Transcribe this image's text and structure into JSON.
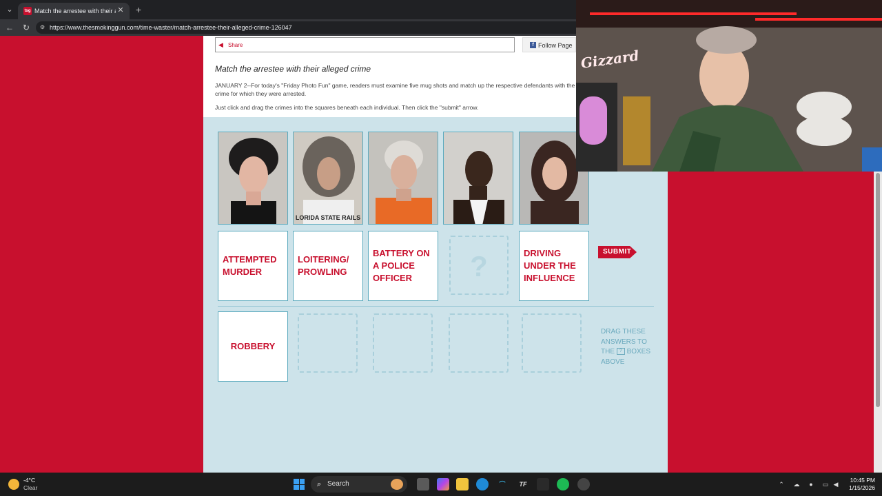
{
  "browser": {
    "tab_title": "Match the arrestee with their alleg",
    "tab_favicon": "tsg",
    "url": "https://www.thesmokinggun.com/time-waster/match-arrestee-their-alleged-crime-126047"
  },
  "page": {
    "share_label": "Share",
    "follow_label": "Follow Page",
    "headline": "Match the arrestee with their alleged crime",
    "body1": "JANUARY 2--For today's \"Friday Photo Fun\" game, readers must examine five mug shots and match up the respective defendants with the crime for which they were arrested.",
    "body2": "Just click and drag the crimes into the squares beneath each individual. Then click the \"submit\" arrow."
  },
  "game": {
    "mugshots": [
      {
        "shirt_text": ""
      },
      {
        "shirt_text": "LORIDA STATE RAILS"
      },
      {
        "shirt_text": ""
      },
      {
        "shirt_text": ""
      },
      {
        "shirt_text": ""
      }
    ],
    "placed_answers": [
      "ATTEMPTED MURDER",
      "LOITERING/ PROWLING",
      "BATTERY ON A POLICE OFFICER",
      "?",
      "DRIVING UNDER THE INFLUENCE"
    ],
    "answer_pool": [
      "ROBBERY"
    ],
    "submit_label": "SUBMIT",
    "drag_hint_1": "DRAG THESE ANSWERS TO THE",
    "drag_hint_box": "?",
    "drag_hint_2": "BOXES ABOVE"
  },
  "webcam": {
    "neon_sign": "Gizzard"
  },
  "taskbar": {
    "temperature": "-4°C",
    "condition": "Clear",
    "search_label": "Search",
    "time": "10:45 PM",
    "date": "1/15/2026"
  },
  "colors": {
    "brand_red": "#c8102e",
    "game_bg": "#cde3ea"
  }
}
